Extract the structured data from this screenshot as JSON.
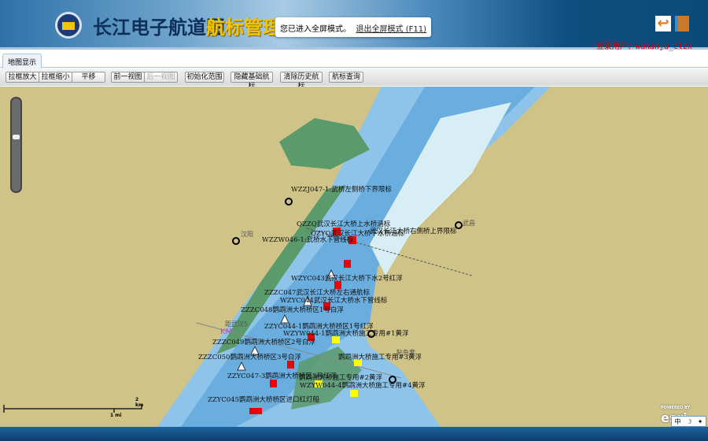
{
  "header": {
    "app_title": "长江电子航道图",
    "sub_title": "航标管理",
    "user_label": "登录用户：wuhanju_clzx"
  },
  "fullscreen_notice": {
    "message": "您已进入全屏模式。",
    "exit_link": "退出全屏模式 (F11)"
  },
  "tabs": [
    {
      "label": "地图显示",
      "active": true
    }
  ],
  "toolbar": {
    "buttons": [
      "拉框放大",
      "拉框缩小",
      "平移",
      "前一视图",
      "后一视图",
      "初始化范围",
      "隐藏基础航标",
      "清除历史航标",
      "航标查询"
    ],
    "disabled": [
      "后一视图"
    ]
  },
  "map": {
    "places": [
      "汉阳",
      "武昌",
      "距武汉5",
      "KM",
      "鲇鱼套"
    ],
    "labels": [
      "WZZJ047-1:武桥左侧桥下界限标",
      "QZZQ武汉长江大桥上水桥涵标",
      "QZYQ武汉长江大桥下水桥涵标",
      "WZZW046-1:武桥水下管线标",
      "武汉长江大桥右侧桥上界限标",
      "WZYC043武汉长江大桥下水2号红浮",
      "ZZZC047武汉长江大桥左右通航标",
      "WZYC044武汉长江大桥水下管线标",
      "ZZZC048鹦鹉洲大桥桥区1号白浮",
      "ZZYC044-1鹦鹉洲大桥桥区1号红浮",
      "WZYW044-1鹦鹉洲大桥施工专用#1黄浮",
      "ZZZC049鹦鹉洲大桥桥区2号白浮",
      "ZZZC050鹦鹉洲大桥桥区3号白浮",
      "鹦鹉洲大桥施工专用#3黄浮",
      "ZZYC047-3鹦鹉洲大桥桥区3号红浮",
      "鹦鹉洲大桥施工专用#2黄浮",
      "WZYW044-4鹦鹉洲大桥施工专用#4黄浮",
      "ZZYC045鹦鹉洲大桥桥区进口红灯船"
    ],
    "scale": {
      "km": "2 km",
      "mi": "1 mi"
    },
    "attribution": "POWERED BY esri"
  },
  "ime": {
    "items": [
      "中",
      "☽",
      "✦"
    ]
  }
}
